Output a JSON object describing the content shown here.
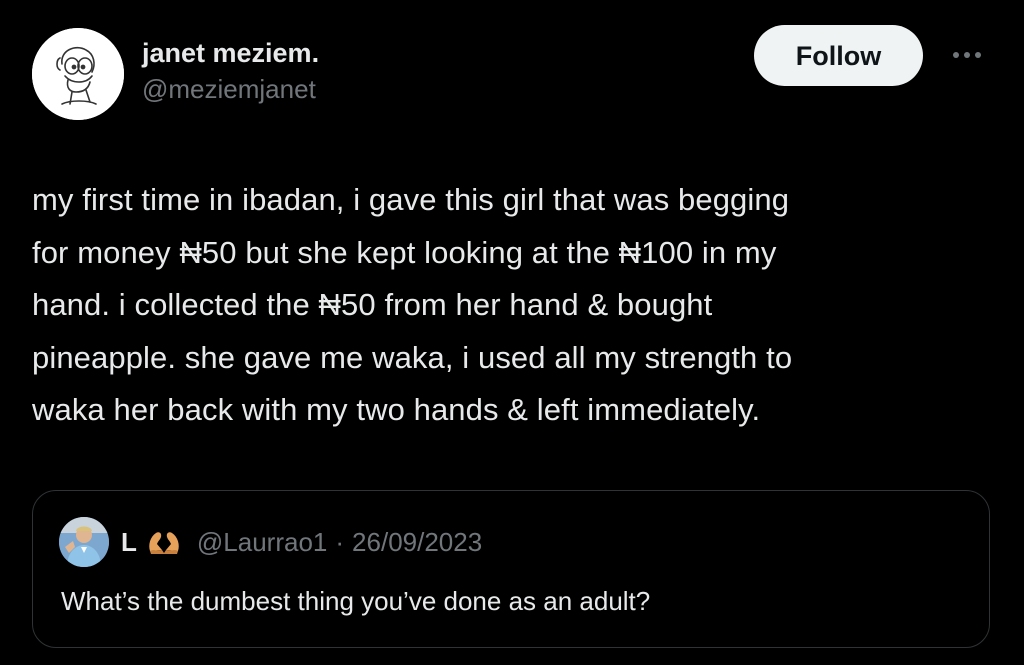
{
  "author": {
    "display_name": "janet meziem.",
    "handle": "@meziemjanet",
    "avatar_icon": "cartoon-character-avatar-icon"
  },
  "actions": {
    "follow_label": "Follow",
    "more_icon": "more-horizontal-icon"
  },
  "tweet": {
    "text": "my first time in ibadan, i gave this girl that was begging\nfor money ₦50 but she kept looking at the ₦100 in my\nhand. i collected the ₦50 from her hand & bought\npineapple. she gave me waka, i used all my strength to\nwaka her back with my two hands & left immediately."
  },
  "quoted_tweet": {
    "display_name": "L",
    "name_emoji": "heart-hands-icon",
    "handle": "@Laurrao1",
    "separator": "·",
    "date": "26/09/2023",
    "text": "What’s the dumbest thing you’ve done as an adult?"
  },
  "colors": {
    "background": "#000000",
    "primary_text": "#e7e9ea",
    "secondary_text": "#71767b",
    "follow_bg": "#eff3f4",
    "border": "#2f3336"
  }
}
